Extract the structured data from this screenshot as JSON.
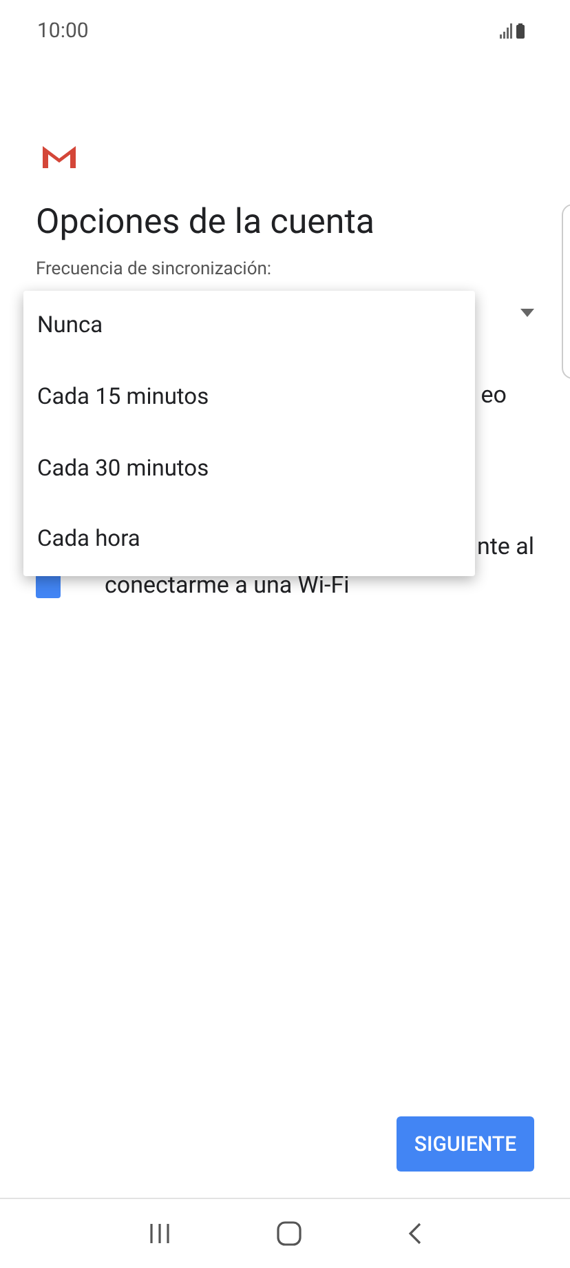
{
  "status_bar": {
    "time": "10:00"
  },
  "title": "Opciones de la cuenta",
  "sync_label": "Frecuencia de sincronización:",
  "background_rows": [
    {
      "kind": "text",
      "text": "eo"
    },
    {
      "kind": "checkbox",
      "checked": true,
      "text_end": "nte al",
      "text_line2": "conectarme a una Wi-Fi"
    }
  ],
  "menu": {
    "items": [
      {
        "label": "Nunca"
      },
      {
        "label": "Cada 15 minutos"
      },
      {
        "label": "Cada 30 minutos"
      },
      {
        "label": "Cada hora"
      }
    ]
  },
  "next_button": "SIGUIENTE"
}
